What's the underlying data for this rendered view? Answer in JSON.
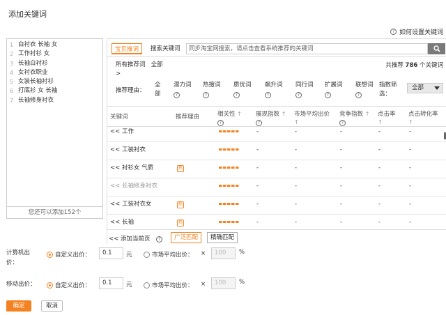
{
  "dialog": {
    "title": "添加关键词",
    "help_link": "如何设置关键词",
    "help_icon": "?"
  },
  "keyword_list": {
    "items": [
      {
        "num": "1",
        "text": "白衬衣 长袖 女"
      },
      {
        "num": "2",
        "text": "工作衬衫 女"
      },
      {
        "num": "3",
        "text": "长袖白衬衫"
      },
      {
        "num": "4",
        "text": "女衬衣职业"
      },
      {
        "num": "5",
        "text": "女装长袖衬衫"
      },
      {
        "num": "6",
        "text": "打底衫 女 长袖"
      },
      {
        "num": "7",
        "text": "长袖修身衬衣"
      }
    ],
    "footer": "您还可以添加152个"
  },
  "tabs": {
    "active": "宝贝推词",
    "other": "搜索关键词"
  },
  "search": {
    "placeholder": "同步淘宝网搜索，请点击查看系统推荐的关键词",
    "icon": "search-icon"
  },
  "filter": {
    "breadcrumb_label": "所有推荐词",
    "breadcrumb_value": "全部",
    "breadcrumb_gt": ">",
    "total_prefix": "共推荐",
    "total_count": "786",
    "total_suffix": "个关键词",
    "reason_label": "推荐理由：",
    "reasons": [
      "全部",
      "潜力词",
      "热搜词",
      "质优词",
      "飙升词",
      "同行词",
      "扩展词",
      "联想词"
    ],
    "reason_all_line1": "全",
    "reason_all_line2": "部",
    "index_filter_line1": "指数筛",
    "index_filter_line2": "选：",
    "index_select": "全部"
  },
  "table": {
    "headers": {
      "keyword": "关键词",
      "reason": "推荐理由",
      "relevance": "相关性",
      "impressions": "展现指数",
      "avg_price": "市场平均出价",
      "competition": "竞争指数",
      "ctr": "点击率",
      "cvr": "点击转化率"
    },
    "rows": [
      {
        "prefix": "<<",
        "keyword": "工作",
        "hot": "",
        "rel": "=====",
        "c1": "-",
        "c2": "-",
        "c3": "-",
        "c4": "-",
        "c5": "-",
        "grey": false
      },
      {
        "prefix": "<<",
        "keyword": "工装衬衣",
        "hot": "",
        "rel": "=====",
        "c1": "-",
        "c2": "-",
        "c3": "-",
        "c4": "-",
        "c5": "-",
        "grey": false
      },
      {
        "prefix": "<<",
        "keyword": "衬衫女 气质",
        "hot": "热",
        "rel": "=====",
        "c1": "-",
        "c2": "-",
        "c3": "-",
        "c4": "-",
        "c5": "-",
        "grey": false
      },
      {
        "prefix": "<<",
        "keyword": "长袖修身衬衣",
        "hot": "",
        "rel": "=====",
        "c1": "-",
        "c2": "-",
        "c3": "-",
        "c4": "-",
        "c5": "-",
        "grey": true
      },
      {
        "prefix": "<<",
        "keyword": "工装衬衣女",
        "hot": "热",
        "rel": "=====",
        "c1": "-",
        "c2": "-",
        "c3": "-",
        "c4": "-",
        "c5": "-",
        "grey": false
      },
      {
        "prefix": "<<",
        "keyword": "长袖",
        "hot": "热",
        "rel": "=====",
        "c1": "-",
        "c2": "-",
        "c3": "-",
        "c4": "-",
        "c5": "-",
        "grey": false
      }
    ],
    "footer": {
      "add_page": "<<  添加当前页",
      "broad_match": "广泛匹配",
      "exact_match": "精确匹配"
    }
  },
  "bids": {
    "computer": {
      "label_line1": "计算机出",
      "label_line2": "价：",
      "custom_label": "自定义出价：",
      "custom_value": "0.1",
      "unit": "元",
      "market_label": "市场平均出价：",
      "times": "×",
      "percent_value": "100",
      "percent_sign": "%"
    },
    "mobile": {
      "label": "移动出价：",
      "custom_label": "自定义出价：",
      "custom_value": "0.1",
      "unit": "元",
      "market_label": "市场平均出价：",
      "times": "×",
      "percent_value": "100",
      "percent_sign": "%"
    }
  },
  "actions": {
    "ok": "确定",
    "cancel": "取消"
  },
  "colors": {
    "accent": "#f58220",
    "search_button": "#7a7a7a"
  }
}
